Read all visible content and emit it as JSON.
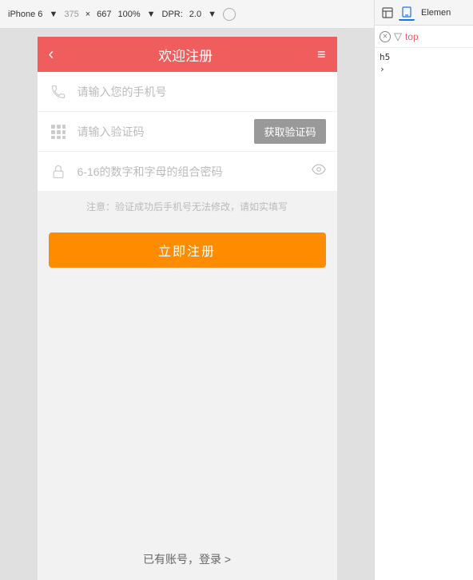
{
  "device_toolbar": {
    "device_name": "iPhone 6",
    "width": "375",
    "x": "×",
    "height": "667",
    "zoom": "100%",
    "dpr_label": "DPR:",
    "dpr_value": "2.0"
  },
  "app": {
    "header": {
      "title": "欢迎注册",
      "back_icon": "‹",
      "menu_icon": "≡"
    },
    "form": {
      "phone_placeholder": "请输入您的手机号",
      "sms_placeholder": "请输入验证码",
      "sms_button": "获取验证码",
      "password_placeholder": "6-16的数字和字母的组合密码"
    },
    "notice": "注意：验证成功后手机号无法修改，请如实填写",
    "register_button": "立即注册",
    "login_link": "已有账号，登录 >"
  },
  "devtools": {
    "tabs": [
      {
        "label": "□",
        "title": "Elements panel icon"
      },
      {
        "label": "◫",
        "title": "Device toolbar icon"
      }
    ],
    "panel_label": "Elemen",
    "filter_label": "top",
    "tree": {
      "h5": "h5",
      "arrow": "›"
    }
  }
}
